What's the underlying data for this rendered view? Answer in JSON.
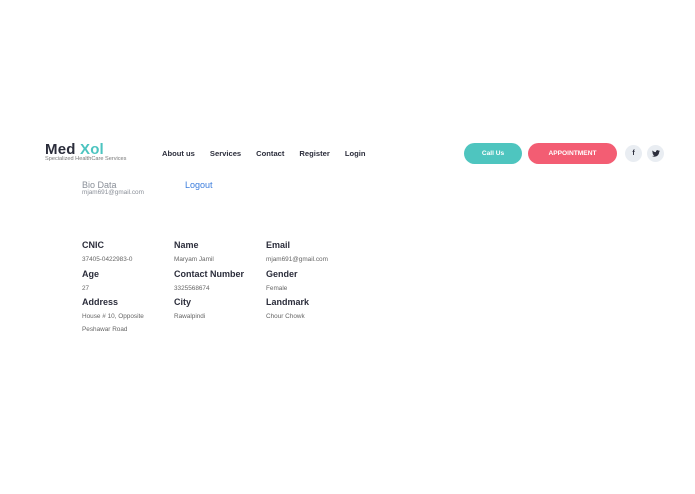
{
  "brand": {
    "name_part1": "Med",
    "name_part2": "Xol",
    "tagline": "Specialized HealthCare Services"
  },
  "nav": {
    "items": [
      "About us",
      "Services",
      "Contact",
      "Register",
      "Login"
    ]
  },
  "header": {
    "call_label": "Call Us",
    "appointment_label": "APPOINTMENT",
    "facebook_glyph": "f",
    "twitter_glyph": "🐦"
  },
  "profile": {
    "section_title": "Bio Data",
    "email": "mjam691@gmail.com",
    "logout_label": "Logout"
  },
  "fields": {
    "cnic": {
      "label": "CNIC",
      "value": "37405-0422983-0"
    },
    "name": {
      "label": "Name",
      "value": "Maryam Jamil"
    },
    "email": {
      "label": "Email",
      "value": "mjam691@gmail.com"
    },
    "age": {
      "label": "Age",
      "value": "27"
    },
    "contact": {
      "label": "Contact Number",
      "value": "3325568674"
    },
    "gender": {
      "label": "Gender",
      "value": "Female"
    },
    "address": {
      "label": "Address",
      "value_line1": "House # 10, Opposite",
      "value_line2": "Peshawar Road"
    },
    "city": {
      "label": "City",
      "value": "Rawalpindi"
    },
    "landmark": {
      "label": "Landmark",
      "value": "Chour Chowk"
    }
  },
  "colors": {
    "accent": "#4cc4c0",
    "appointment": "#f35d73",
    "link": "#3b7ddd"
  }
}
